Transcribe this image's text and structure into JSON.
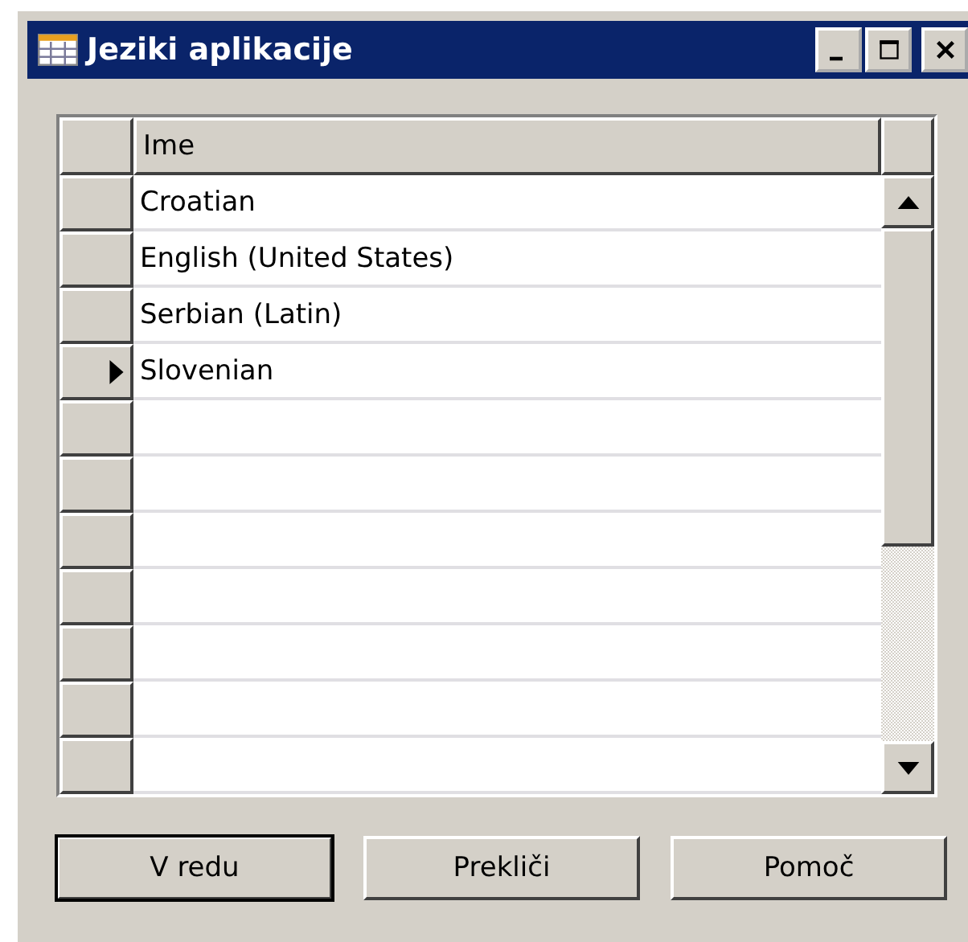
{
  "window": {
    "title": "Jeziki aplikacije"
  },
  "table": {
    "columns": [
      "Ime"
    ],
    "rows": [
      {
        "cells": [
          "Croatian"
        ],
        "current": false
      },
      {
        "cells": [
          "English (United States)"
        ],
        "current": false
      },
      {
        "cells": [
          "Serbian (Latin)"
        ],
        "current": false
      },
      {
        "cells": [
          "Slovenian"
        ],
        "current": true
      },
      {
        "cells": [],
        "current": false
      },
      {
        "cells": [],
        "current": false
      },
      {
        "cells": [],
        "current": false
      },
      {
        "cells": [],
        "current": false
      },
      {
        "cells": [],
        "current": false
      },
      {
        "cells": [],
        "current": false
      },
      {
        "cells": [],
        "current": false
      }
    ]
  },
  "buttons": [
    {
      "label": "V redu",
      "default": true
    },
    {
      "label": "Prekliči",
      "default": false
    },
    {
      "label": "Pomoč",
      "default": false
    }
  ]
}
